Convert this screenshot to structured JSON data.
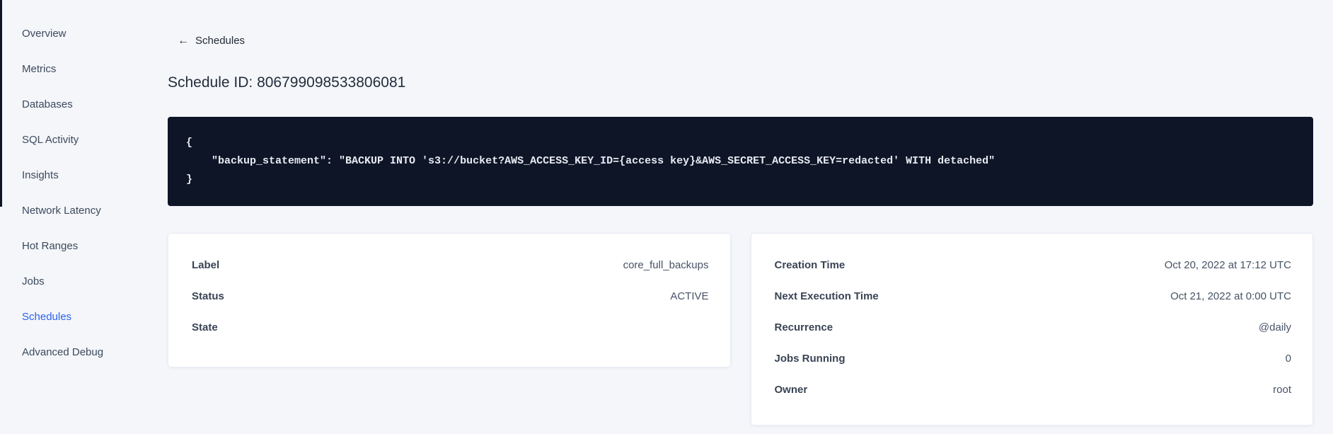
{
  "app": {
    "page_bg": "#f4f6fa",
    "accent_color": "#2b61f2",
    "code_bg": "#0e1527"
  },
  "sidebar": {
    "items": [
      {
        "label": "Overview",
        "active": false
      },
      {
        "label": "Metrics",
        "active": false
      },
      {
        "label": "Databases",
        "active": false
      },
      {
        "label": "SQL Activity",
        "active": false
      },
      {
        "label": "Insights",
        "active": false
      },
      {
        "label": "Network Latency",
        "active": false
      },
      {
        "label": "Hot Ranges",
        "active": false
      },
      {
        "label": "Jobs",
        "active": false
      },
      {
        "label": "Schedules",
        "active": true
      },
      {
        "label": "Advanced Debug",
        "active": false
      }
    ]
  },
  "header": {
    "back_icon": "←",
    "back_label": "Schedules",
    "title": "Schedule ID: 806799098533806081"
  },
  "code_block": {
    "lines": [
      "{",
      "    \"backup_statement\": \"BACKUP INTO 's3://bucket?AWS_ACCESS_KEY_ID={access key}&AWS_SECRET_ACCESS_KEY=redacted' WITH detached\"",
      "}"
    ]
  },
  "details_card": {
    "rows": [
      {
        "label": "Label",
        "value": "core_full_backups"
      },
      {
        "label": "Status",
        "value": "ACTIVE"
      },
      {
        "label": "State",
        "value": ""
      }
    ]
  },
  "schedule_card": {
    "rows": [
      {
        "label": "Creation Time",
        "value": "Oct 20, 2022 at 17:12 UTC"
      },
      {
        "label": "Next Execution Time",
        "value": "Oct 21, 2022 at 0:00 UTC"
      },
      {
        "label": "Recurrence",
        "value": "@daily"
      },
      {
        "label": "Jobs Running",
        "value": "0"
      },
      {
        "label": "Owner",
        "value": "root"
      }
    ]
  }
}
